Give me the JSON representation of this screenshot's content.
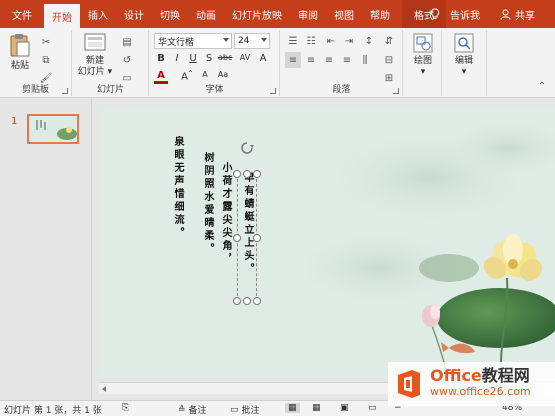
{
  "tabs": [
    "文件",
    "开始",
    "插入",
    "设计",
    "切换",
    "动画",
    "幻灯片放映",
    "审阅",
    "视图",
    "帮助",
    "格式"
  ],
  "active_tab": "开始",
  "tell_me": "告诉我",
  "share": "共享",
  "ribbon": {
    "clipboard": {
      "paste_label": "粘贴",
      "group_label": "剪贴板"
    },
    "slides": {
      "new_slide_label": "新建\n幻灯片",
      "group_label": "幻灯片"
    },
    "font": {
      "font_name": "华文行楷",
      "font_size": "24",
      "group_label": "字体",
      "font_color": "#c00000"
    },
    "paragraph": {
      "group_label": "段落"
    },
    "drawing": {
      "label": "绘图"
    },
    "editing": {
      "label": "编辑"
    }
  },
  "thumbnail": {
    "number": "1"
  },
  "slide": {
    "poem_columns": [
      "泉眼无声惜细流。",
      "树阴照水爱晴柔。",
      "小荷才露尖尖角，",
      "早有蜻蜓立上头。"
    ]
  },
  "status": {
    "slide_info": "幻灯片 第 1 张，共 1 张",
    "notes": "备注",
    "comments": "批注",
    "zoom": "48%"
  },
  "watermark": {
    "line1_a": "Office",
    "line1_b": "教程网",
    "line2": "www.office26.com"
  },
  "colors": {
    "accent": "#c43e1c",
    "slide_bg": "#dfece6"
  }
}
